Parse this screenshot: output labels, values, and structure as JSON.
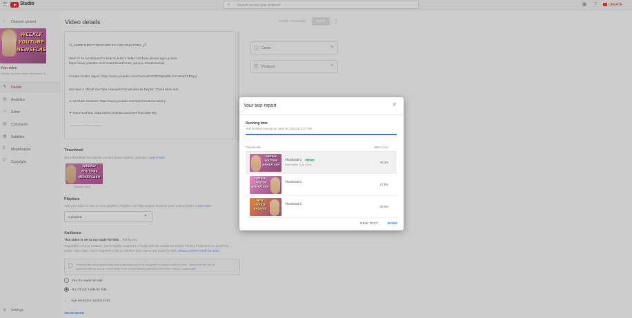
{
  "topbar": {
    "logo_text": "Studio",
    "search_placeholder": "Search across your channel",
    "create_label": "CREATE"
  },
  "sidebar": {
    "back_label": "Channel content",
    "thumb_text": [
      "WEEKLY",
      "YOUTUBE",
      "NEWSFLASH"
    ],
    "your_video": "Your video",
    "video_sub": "Weekly YouTube News Newsflash! F...",
    "items": [
      {
        "label": "Details",
        "icon": "pencil-icon",
        "active": true
      },
      {
        "label": "Analytics",
        "icon": "analytics-icon",
        "active": false
      },
      {
        "label": "Editor",
        "icon": "editor-icon",
        "active": false
      },
      {
        "label": "Comments",
        "icon": "comments-icon",
        "active": false
      },
      {
        "label": "Subtitles",
        "icon": "subtitles-icon",
        "active": false
      },
      {
        "label": "Monetization",
        "icon": "monetization-icon",
        "active": false
      },
      {
        "label": "Copyright",
        "icon": "copyright-icon",
        "active": false
      }
    ],
    "settings_label": "Settings"
  },
  "main": {
    "title": "Video details",
    "undo_label": "UNDO CHANGES",
    "save_label": "SAVE",
    "description_lines": [
      "🔍 MORE GREAT RESOURCES FOR CREATORS 🔎",
      "Want to be considered for help so build a better YouTube please sign up here",
      "https://www.youtube.com/creators/earth?utm_source=Creatorinsider",
      "Creator Insider Japan: https://www.youtube.com/channel/UCBf7Mqhwf8nVrYmRWXXDsyQ",
      "We have 2 official YouTube channels that will also be helpful. Check them out!",
      "➡ YouTube Creators: https://www.youtube.com/user/creatoracademy",
      "➡ TeamYouTube: https://www.youtube.com/user/YouTubeHelp",
      "___________________"
    ],
    "thumbnail": {
      "heading": "Thumbnail",
      "sub": "Set a thumbnail that stands out and draws viewers' attention.",
      "sub_link": "Learn more",
      "thumb_text": [
        "WEEKLY",
        "YOUTUBE",
        "NEWSFLASH"
      ],
      "caption": "Results ready"
    },
    "playlists": {
      "heading": "Playlists",
      "sub": "Add your video to one or more playlists. Playlists can help viewers discover your content faster.",
      "sub_link": "Learn more",
      "value": "2 playlists"
    },
    "audience": {
      "heading": "Audience",
      "status": "This video is set to not made for kids",
      "status_note": "Set by you",
      "desc1": "Regardless of your location, you're legally required to comply with the Children's Online Privacy Protection Act (COPPA)",
      "desc2": "and/or other laws. You're required to tell us whether your videos are made for kids.",
      "desc_link": "What's content made for kids?",
      "info1": "Features like personalized ads and notifications won't be available on videos made for kids. Videos that are set as",
      "info2": "made for kids by you are more likely to be recommended alongside other kids' videos.",
      "info_link": "Learn more",
      "options": [
        "Yes, it's made for kids",
        "No, it's not made for kids"
      ],
      "selected": 1,
      "age_label": "Age restriction (advanced)"
    },
    "show_more": "SHOW MORE"
  },
  "right_cards": [
    {
      "label": "Cards",
      "icon": "cards-icon"
    },
    {
      "label": "Products",
      "icon": "shopping-bag-icon"
    }
  ],
  "modal": {
    "title": "Your test report",
    "running_heading": "Running time",
    "running_sub": "Test finished running on June 30, 2023 at 2:17 PM",
    "progress": 1.0,
    "col_thumbnails": "Thumbnails",
    "col_watch_time": "Watch time",
    "rows": [
      {
        "name": "Thumbnail 1",
        "badge": "Winner",
        "sub": "Now visible to all users",
        "share": "40.3%",
        "text": [
          "WEEKLY",
          "YOUTUBE",
          "NEWSFLASH"
        ],
        "bg": "#c96fa4",
        "txt": "#ffffff"
      },
      {
        "name": "Thumbnail 2",
        "badge": "",
        "sub": "",
        "share": "27.9%",
        "text": [
          "WEEKLY",
          "CREATOR",
          "NEWSFLASH"
        ],
        "bg": "#e986c8",
        "txt": "#ffffff"
      },
      {
        "name": "Thumbnail 3",
        "badge": "",
        "sub": "",
        "share": "28.9%",
        "text": [
          "NEW",
          "WEEKLY",
          "UPDATES"
        ],
        "bg": "#e8823a",
        "txt": "#fff6a8"
      }
    ],
    "new_test_label": "NEW TEST",
    "done_label": "DONE"
  }
}
